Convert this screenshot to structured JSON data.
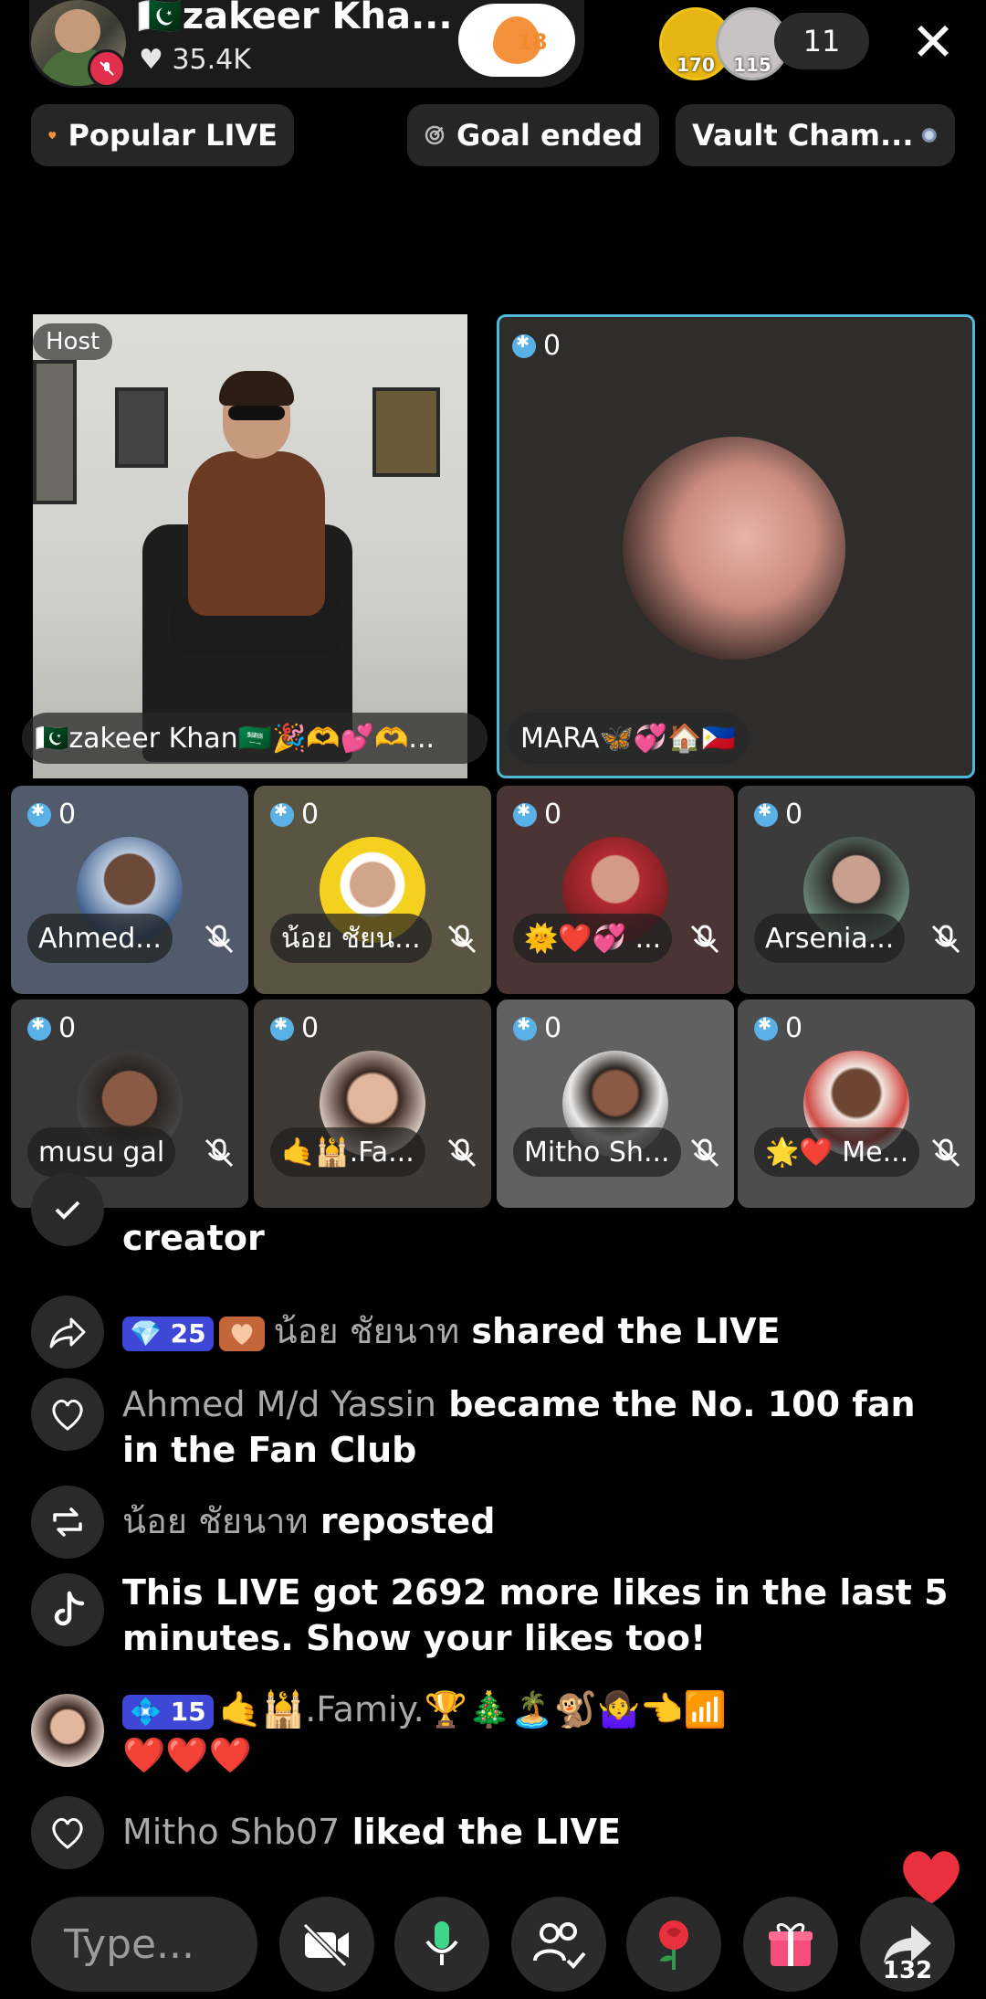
{
  "header": {
    "host_name": "🇵🇰zakeer Kha...",
    "likes": "35.4K",
    "fan_level": "18",
    "viewers": [
      {
        "level": "170"
      },
      {
        "level": "115"
      }
    ],
    "viewer_count": "11",
    "close_symbol": "✕"
  },
  "chips": {
    "popular": "Popular LIVE",
    "goal": "Goal ended",
    "vault": "Vault Cham..."
  },
  "host_tile": {
    "tag": "Host",
    "name": "🇵🇰zakeer Khan🇸🇦🎉🫶💕🫶..."
  },
  "main_guest": {
    "score": "0",
    "name": "MARA🦋💞🏠🇵🇭"
  },
  "guests": [
    {
      "name": "Ahmed...",
      "score": "0"
    },
    {
      "name": "น้อย ชัยน...",
      "score": "0"
    },
    {
      "name": "🌞❤️💞 ...",
      "score": "0"
    },
    {
      "name": "Arsenia...",
      "score": "0"
    },
    {
      "name": "musu gal",
      "score": "0"
    },
    {
      "name": "🤙🕌.Fa...",
      "score": "0"
    },
    {
      "name": "Mitho Sh...",
      "score": "0"
    },
    {
      "name": "🌟❤️ Me...",
      "score": "0"
    }
  ],
  "comments": {
    "c0_text": "creator",
    "c1_badge": "25",
    "c1_user": "น้อย ชัยนาท",
    "c1_action": "shared the LIVE",
    "c2_user": "Ahmed M/d Yassin",
    "c2_action": "became the No. 100 fan in the Fan Club",
    "c3_user": "น้อย ชัยนาท",
    "c3_action": "reposted",
    "c4_text": "This LIVE got 2692 more likes in the last 5 minutes. Show your likes too!",
    "c5_badge": "15",
    "c5_user": "🤙🕌.Famiy.🏆🎄🏝️🐒🤷‍♀️👈📶",
    "c5_message": "❤️❤️❤️",
    "c6_user": "Mitho Shb07",
    "c6_action": "liked the LIVE"
  },
  "bottom_bar": {
    "placeholder": "Type...",
    "share_count": "132"
  },
  "colors": {
    "accent_blue": "#4fb8d8",
    "mute_red": "#e0304e",
    "fan_orange": "#f5913b",
    "badge_blue": "#3f47d6"
  }
}
